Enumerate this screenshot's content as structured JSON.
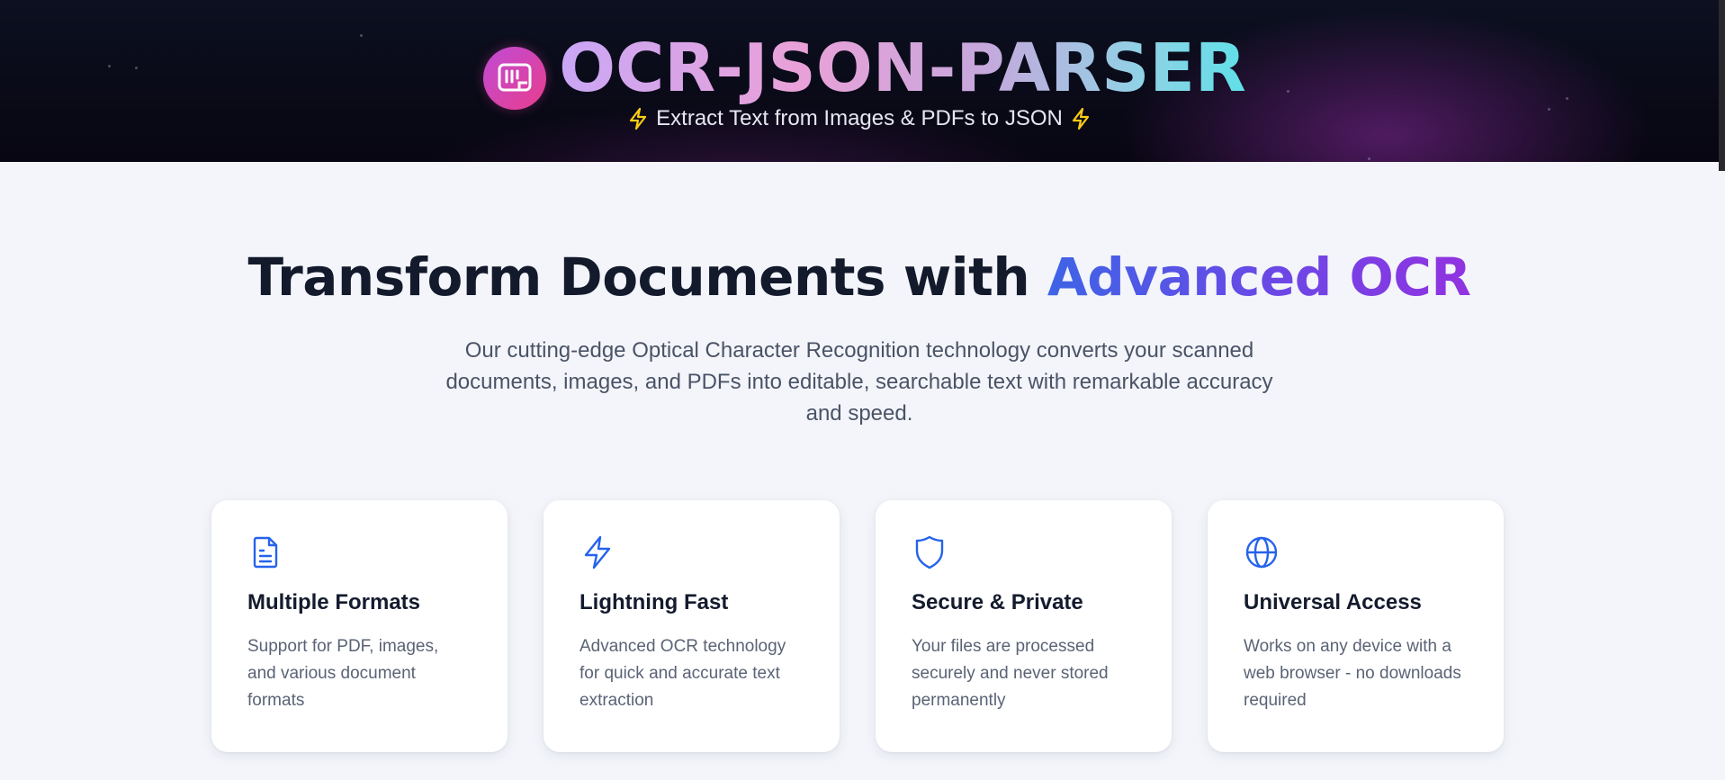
{
  "header": {
    "title": "OCR-JSON-PARSER",
    "tagline": "Extract Text from Images & PDFs to JSON",
    "logo_icon": "receipt-icon",
    "bolt_icon": "lightning-icon"
  },
  "hero": {
    "title_main": "Transform Documents with ",
    "title_accent": "Advanced OCR",
    "subtitle": "Our cutting-edge Optical Character Recognition technology converts your scanned documents, images, and PDFs into editable, searchable text with remarkable accuracy and speed."
  },
  "features": [
    {
      "icon": "file-text-icon",
      "title": "Multiple Formats",
      "description": "Support for PDF, images, and various document formats"
    },
    {
      "icon": "zap-icon",
      "title": "Lightning Fast",
      "description": "Advanced OCR technology for quick and accurate text extraction"
    },
    {
      "icon": "shield-icon",
      "title": "Secure & Private",
      "description": "Your files are processed securely and never stored permanently"
    },
    {
      "icon": "globe-icon",
      "title": "Universal Access",
      "description": "Works on any device with a web browser - no downloads required"
    }
  ],
  "colors": {
    "accent_blue": "#2563eb",
    "bolt_yellow": "#facc15",
    "logo_gradient_start": "#c04bd6",
    "logo_gradient_end": "#e83e8c"
  }
}
